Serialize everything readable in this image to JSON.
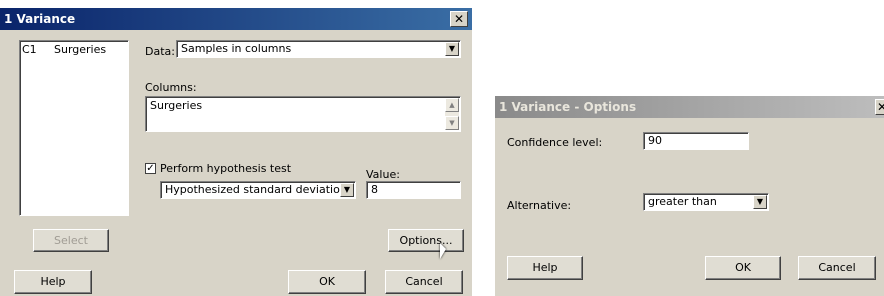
{
  "main_dialog": {
    "title": "1 Variance",
    "close_glyph": "✕",
    "variable_list": [
      {
        "col": "C1",
        "name": "Surgeries"
      }
    ],
    "data_label": "Data:",
    "data_value": "Samples in columns",
    "columns_label": "Columns:",
    "columns_value": "Surgeries",
    "perform_test_label": "Perform hypothesis test",
    "perform_test_checked": true,
    "hypothesis_type_value": "Hypothesized standard deviation",
    "value_label": "Value:",
    "value_value": "8",
    "select_button": "Select",
    "options_button": "Options...",
    "help_button": "Help",
    "ok_button": "OK",
    "cancel_button": "Cancel"
  },
  "options_dialog": {
    "title": "1 Variance - Options",
    "close_glyph": "✕",
    "confidence_label": "Confidence level:",
    "confidence_value": "90",
    "alternative_label": "Alternative:",
    "alternative_value": "greater than",
    "help_button": "Help",
    "ok_button": "OK",
    "cancel_button": "Cancel"
  },
  "colors": {
    "title_active": "#0a246a",
    "title_inactive": "#8a8a8a",
    "dialog_bg": "#d8d4c8"
  }
}
